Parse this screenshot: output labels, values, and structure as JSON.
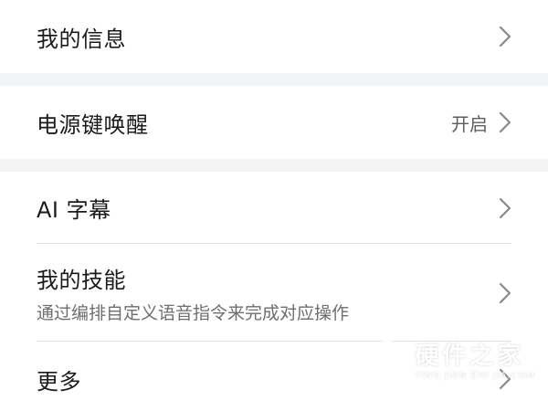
{
  "sections": [
    {
      "items": [
        {
          "title": "我的信息",
          "value": "",
          "subtitle": ""
        }
      ]
    },
    {
      "items": [
        {
          "title": "电源键唤醒",
          "value": "开启",
          "subtitle": ""
        }
      ]
    },
    {
      "items": [
        {
          "title": "AI 字幕",
          "value": "",
          "subtitle": ""
        },
        {
          "title": "我的技能",
          "value": "",
          "subtitle": "通过编排自定义语音指令来完成对应操作"
        },
        {
          "title": "更多",
          "value": "",
          "subtitle": ""
        }
      ]
    }
  ],
  "watermark": {
    "cn": "硬件之家",
    "en": "YING JIAN ZHI JIA.COM"
  },
  "colors": {
    "background": "#ffffff",
    "section_gap": "#f1f3f5",
    "title_text": "#1b1b1b",
    "secondary_text": "#6e6e6e",
    "chevron": "#8a8a8a"
  },
  "icons": {
    "chevron": "chevron-right-icon",
    "watermark_logo": "cube-logo-icon"
  }
}
